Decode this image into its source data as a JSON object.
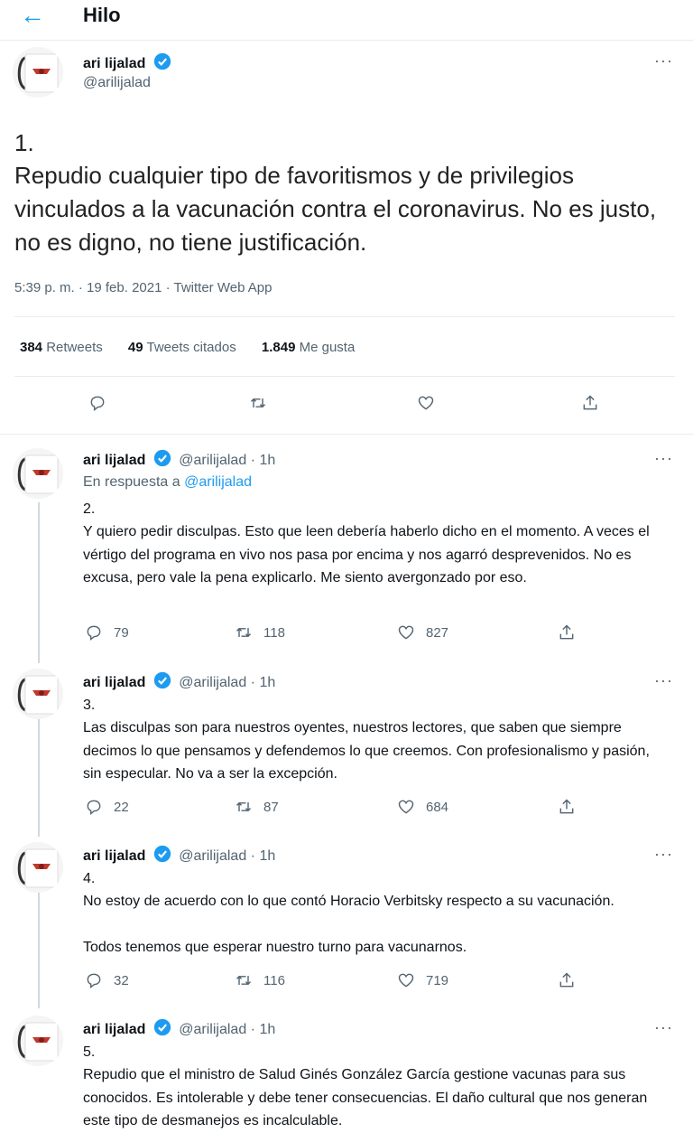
{
  "header": {
    "back_icon": "arrow-left-icon",
    "title": "Hilo"
  },
  "colors": {
    "accent": "#1d9bf0",
    "secondary_text": "#536471",
    "border": "#e6ecf0"
  },
  "main_tweet": {
    "name": "ari lijalad",
    "handle": "@arilijalad",
    "more": "···",
    "number": "1.",
    "text": "Repudio cualquier tipo de favoritismos y de privilegios vinculados a la vacunación contra el coronavirus. No es justo, no es digno, no tiene justificación.",
    "timestamp": "5:39 p. m. · 19 feb. 2021 · Twitter Web App",
    "retweets_count": "384",
    "retweets_label": "Retweets",
    "quotes_count": "49",
    "quotes_label": "Tweets citados",
    "likes_count": "1.849",
    "likes_label": "Me gusta"
  },
  "replies": [
    {
      "name": "ari lijalad",
      "handle": "@arilijalad",
      "time": "· 1h",
      "more": "···",
      "reply_to_label": "En respuesta a",
      "reply_to_mention": "@arilijalad",
      "number": "2.",
      "text": "Y quiero pedir disculpas. Esto que leen debería haberlo dicho en el momento. A veces el vértigo del programa en vivo nos pasa por encima y nos agarró desprevenidos. No es excusa, pero vale la pena explicarlo. Me siento avergonzado por eso.",
      "replies": "79",
      "retweets": "118",
      "likes": "827"
    },
    {
      "name": "ari lijalad",
      "handle": "@arilijalad",
      "time": "· 1h",
      "more": "···",
      "number": "3.",
      "text": "Las disculpas son para nuestros oyentes, nuestros lectores, que saben que siempre decimos lo que pensamos y defendemos lo que creemos. Con profesionalismo y pasión, sin especular. No va a ser la excepción.",
      "replies": "22",
      "retweets": "87",
      "likes": "684"
    },
    {
      "name": "ari lijalad",
      "handle": "@arilijalad",
      "time": "· 1h",
      "more": "···",
      "number": "4.",
      "text_line1": "No estoy de acuerdo con lo que contó Horacio Verbitsky respecto a su vacunación.",
      "text_line2": "Todos tenemos que esperar nuestro turno para vacunarnos.",
      "replies": "32",
      "retweets": "116",
      "likes": "719"
    },
    {
      "name": "ari lijalad",
      "handle": "@arilijalad",
      "time": "· 1h",
      "more": "···",
      "number": "5.",
      "text": "Repudio que el ministro de Salud Ginés González García gestione vacunas para sus conocidos. Es intolerable y debe tener consecuencias. El daño cultural que nos generan este tipo de desmanejos es incalculable."
    }
  ]
}
